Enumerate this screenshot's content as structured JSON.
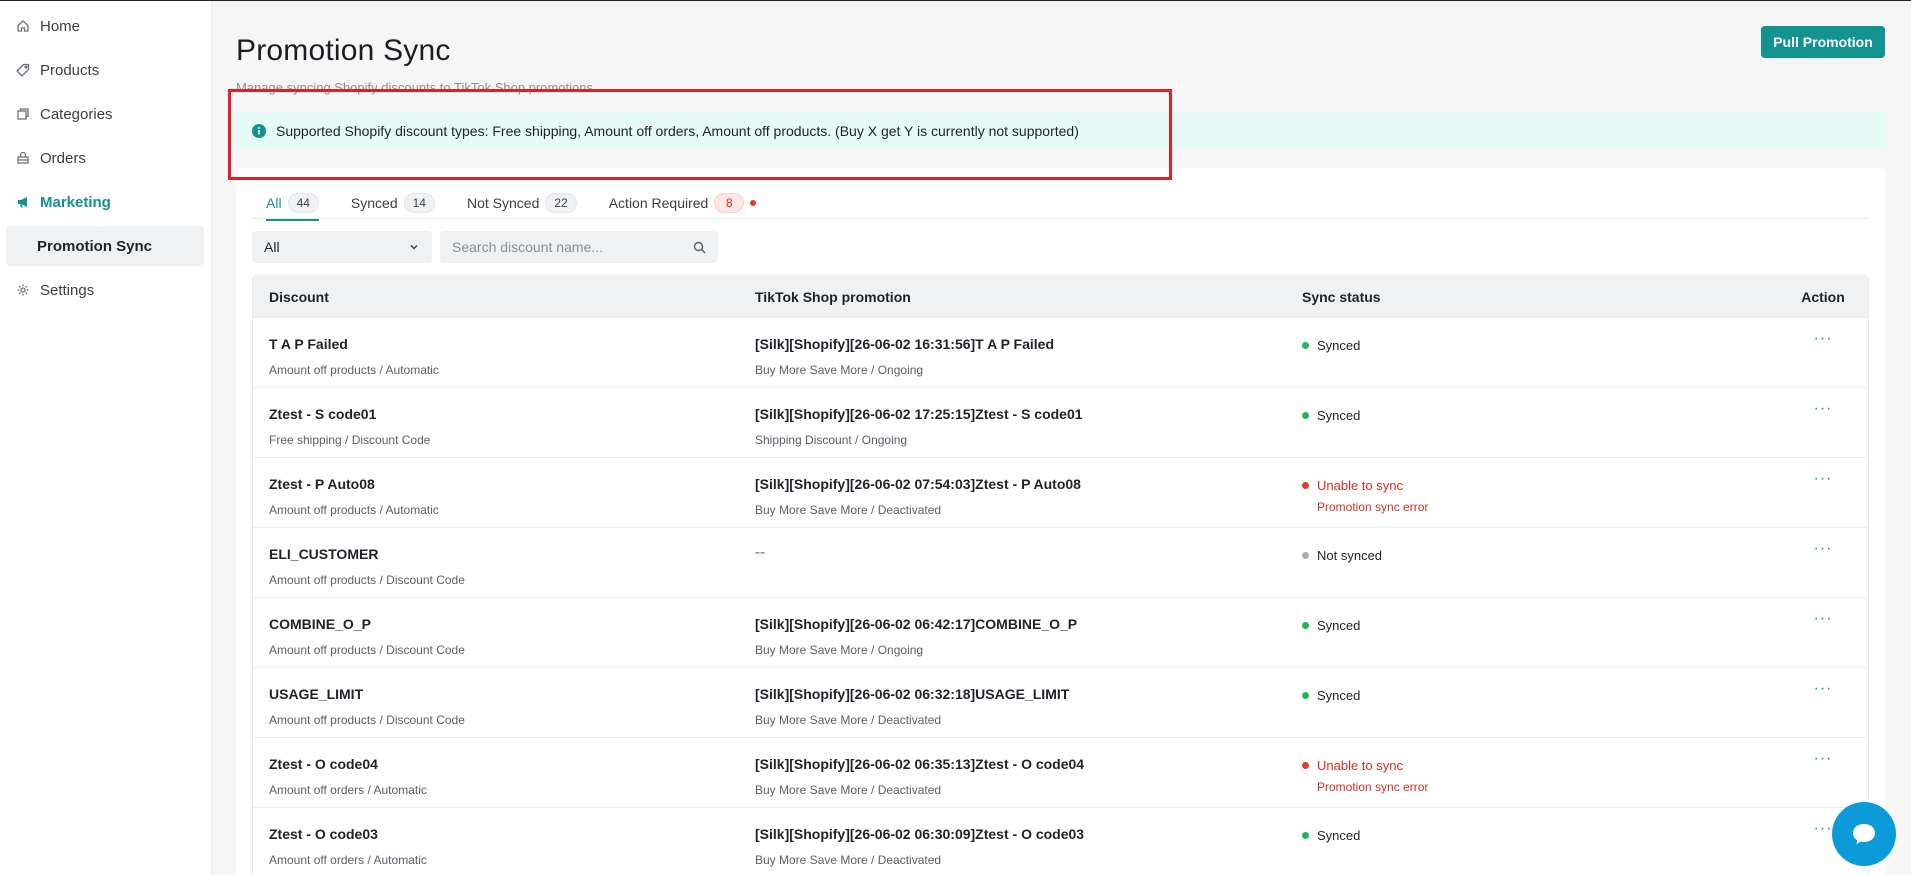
{
  "sidebar": {
    "items": [
      {
        "label": "Home",
        "icon": "home-icon"
      },
      {
        "label": "Products",
        "icon": "tag-icon"
      },
      {
        "label": "Categories",
        "icon": "categories-icon"
      },
      {
        "label": "Orders",
        "icon": "orders-icon"
      },
      {
        "label": "Marketing",
        "icon": "megaphone-icon"
      },
      {
        "label": "Promotion Sync"
      },
      {
        "label": "Settings",
        "icon": "gear-icon"
      }
    ],
    "active_color": "#13928f"
  },
  "header": {
    "title": "Promotion Sync",
    "subtitle": "Manage syncing Shopify discounts to TikTok Shop promotions",
    "pull_button": "Pull Promotion"
  },
  "banner": {
    "text": "Supported Shopify discount types: Free shipping, Amount off orders, Amount off products. (Buy X get Y is currently not supported)"
  },
  "tabs": [
    {
      "label": "All",
      "count": "44"
    },
    {
      "label": "Synced",
      "count": "14"
    },
    {
      "label": "Not Synced",
      "count": "22"
    },
    {
      "label": "Action Required",
      "count": "8"
    }
  ],
  "filter": {
    "selected": "All"
  },
  "search": {
    "placeholder": "Search discount name..."
  },
  "table": {
    "headers": {
      "discount": "Discount",
      "tiktok": "TikTok Shop promotion",
      "sync": "Sync status",
      "action": "Action"
    },
    "rows": [
      {
        "name": "T A P Failed",
        "type": "Amount off products / Automatic",
        "promo": "[Silk][Shopify][26-06-02 16:31:56]T A P Failed",
        "promo_sub": "Buy More Save More / Ongoing",
        "status": "Synced",
        "status_sub": ""
      },
      {
        "name": "Ztest - S code01",
        "type": "Free shipping / Discount Code",
        "promo": "[Silk][Shopify][26-06-02 17:25:15]Ztest - S code01",
        "promo_sub": "Shipping Discount / Ongoing",
        "status": "Synced",
        "status_sub": ""
      },
      {
        "name": "Ztest - P Auto08",
        "type": "Amount off products / Automatic",
        "promo": "[Silk][Shopify][26-06-02 07:54:03]Ztest - P Auto08",
        "promo_sub": "Buy More Save More / Deactivated",
        "status": "Unable to sync",
        "status_sub": "Promotion sync error"
      },
      {
        "name": "ELI_CUSTOMER",
        "type": "Amount off products / Discount Code",
        "promo": "--",
        "promo_sub": "",
        "status": "Not synced",
        "status_sub": ""
      },
      {
        "name": "COMBINE_O_P",
        "type": "Amount off products / Discount Code",
        "promo": "[Silk][Shopify][26-06-02 06:42:17]COMBINE_O_P",
        "promo_sub": "Buy More Save More / Ongoing",
        "status": "Synced",
        "status_sub": ""
      },
      {
        "name": "USAGE_LIMIT",
        "type": "Amount off products / Discount Code",
        "promo": "[Silk][Shopify][26-06-02 06:32:18]USAGE_LIMIT",
        "promo_sub": "Buy More Save More / Deactivated",
        "status": "Synced",
        "status_sub": ""
      },
      {
        "name": "Ztest - O code04",
        "type": "Amount off orders / Automatic",
        "promo": "[Silk][Shopify][26-06-02 06:35:13]Ztest - O code04",
        "promo_sub": "Buy More Save More / Deactivated",
        "status": "Unable to sync",
        "status_sub": "Promotion sync error"
      },
      {
        "name": "Ztest - O code03",
        "type": "Amount off orders / Automatic",
        "promo": "[Silk][Shopify][26-06-02 06:30:09]Ztest - O code03",
        "promo_sub": "Buy More Save More / Deactivated",
        "status": "Synced",
        "status_sub": ""
      }
    ]
  },
  "colors": {
    "brand": "#13928f",
    "synced": "#1db954",
    "error": "#e53935",
    "not_synced": "#a9adb3"
  }
}
